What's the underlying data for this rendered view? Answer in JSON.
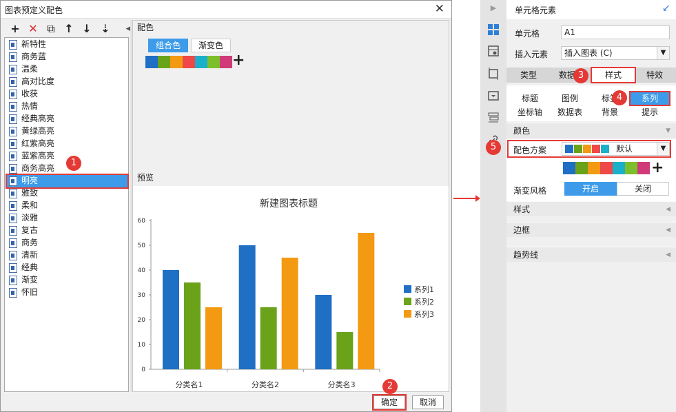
{
  "dialog": {
    "title": "图表预定义配色",
    "close": "✕",
    "toolbar": [
      "+",
      "✕",
      "⧉",
      "↑",
      "↓",
      "⇣"
    ],
    "schemes": [
      "新特性",
      "商务蓝",
      "温柔",
      "高对比度",
      "收获",
      "热情",
      "经典高亮",
      "黄绿高亮",
      "红紫高亮",
      "蓝紫高亮",
      "商务高亮",
      "明亮",
      "雅致",
      "柔和",
      "淡雅",
      "复古",
      "商务",
      "清新",
      "经典",
      "渐变",
      "怀旧"
    ],
    "selected_scheme": "明亮",
    "section_palette": "配色",
    "tab_combo": "组合色",
    "tab_gradient": "渐变色",
    "palette_colors": [
      "#1f6fc5",
      "#6aa31a",
      "#f39a12",
      "#ef4848",
      "#1ab0c9",
      "#7cbf2a",
      "#d13a78"
    ],
    "add_color": "+",
    "section_preview": "预览",
    "ok": "确定",
    "cancel": "取消"
  },
  "chart_data": {
    "type": "bar",
    "title": "新建图表标题",
    "categories": [
      "分类名1",
      "分类名2",
      "分类名3"
    ],
    "series": [
      {
        "name": "系列1",
        "values": [
          40,
          50,
          30
        ],
        "color": "#1f6fc5"
      },
      {
        "name": "系列2",
        "values": [
          35,
          25,
          15
        ],
        "color": "#6aa31a"
      },
      {
        "name": "系列3",
        "values": [
          25,
          45,
          55
        ],
        "color": "#f39a12"
      }
    ],
    "ylim": [
      0,
      60
    ],
    "yticks": [
      0,
      10,
      20,
      30,
      40,
      50,
      60
    ],
    "legend": "right"
  },
  "markers": [
    "1",
    "2",
    "3",
    "4",
    "5"
  ],
  "panel": {
    "title": "单元格元素",
    "cell_label": "单元格",
    "cell_value": "A1",
    "insert_label": "插入元素",
    "insert_value": "插入图表 (C)",
    "tabs": [
      "类型",
      "数据",
      "样式",
      "特效"
    ],
    "sub_tabs_row1": [
      "标题",
      "图例",
      "标签",
      "系列"
    ],
    "sub_tabs_row2": [
      "坐标轴",
      "数据表",
      "背景",
      "提示"
    ],
    "section_color": "颜色",
    "scheme_label": "配色方案",
    "scheme_value": "默认",
    "scheme_colors": [
      "#1f6fc5",
      "#6aa31a",
      "#f39a12",
      "#ef4848",
      "#1ab0c9"
    ],
    "palette_colors": [
      "#1f6fc5",
      "#6aa31a",
      "#f39a12",
      "#ef4848",
      "#1ab0c9",
      "#7cbf2a",
      "#d13a78"
    ],
    "gradient_label": "渐变风格",
    "gradient_on": "开启",
    "gradient_off": "关闭",
    "section_style": "样式",
    "section_border": "边框",
    "section_trend": "趋势线"
  },
  "colors": {
    "accent": "#3d9be9",
    "marker": "#e53935"
  }
}
